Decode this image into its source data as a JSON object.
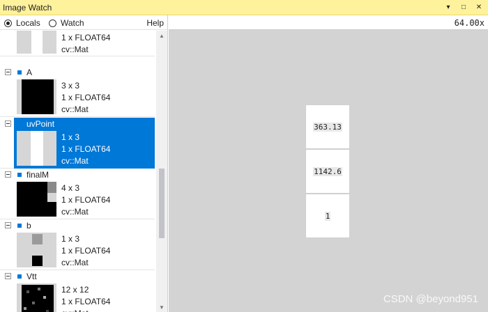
{
  "window": {
    "title": "Image Watch",
    "buttons": {
      "dropdown": "▾",
      "maximize": "□",
      "close": "✕"
    }
  },
  "toolbar": {
    "locals_label": "Locals",
    "watch_label": "Watch",
    "help_label": "Help",
    "selected": "Locals"
  },
  "viewer": {
    "zoom": "64.00x",
    "pixels": [
      "363.13",
      "1142.6",
      "1"
    ],
    "watermark": "CSDN @beyond951"
  },
  "list": {
    "items": [
      {
        "name": "",
        "size": "1 x FLOAT64",
        "type": "cv::Mat",
        "dims": "",
        "partial": true,
        "selected": false
      },
      {
        "name": "A",
        "dims": "3 x 3",
        "size": "1 x FLOAT64",
        "type": "cv::Mat",
        "selected": false
      },
      {
        "name": "uvPoint",
        "dims": "1 x 3",
        "size": "1 x FLOAT64",
        "type": "cv::Mat",
        "selected": true
      },
      {
        "name": "finalM",
        "dims": "4 x 3",
        "size": "1 x FLOAT64",
        "type": "cv::Mat",
        "selected": false
      },
      {
        "name": "b",
        "dims": "1 x 3",
        "size": "1 x FLOAT64",
        "type": "cv::Mat",
        "selected": false
      },
      {
        "name": "Vtt",
        "dims": "12 x 12",
        "size": "1 x FLOAT64",
        "type": "cv::Mat",
        "selected": false
      }
    ]
  },
  "colors": {
    "titlebar": "#fff29d",
    "selection": "#0078d7",
    "viewer_bg": "#d3d3d3"
  }
}
